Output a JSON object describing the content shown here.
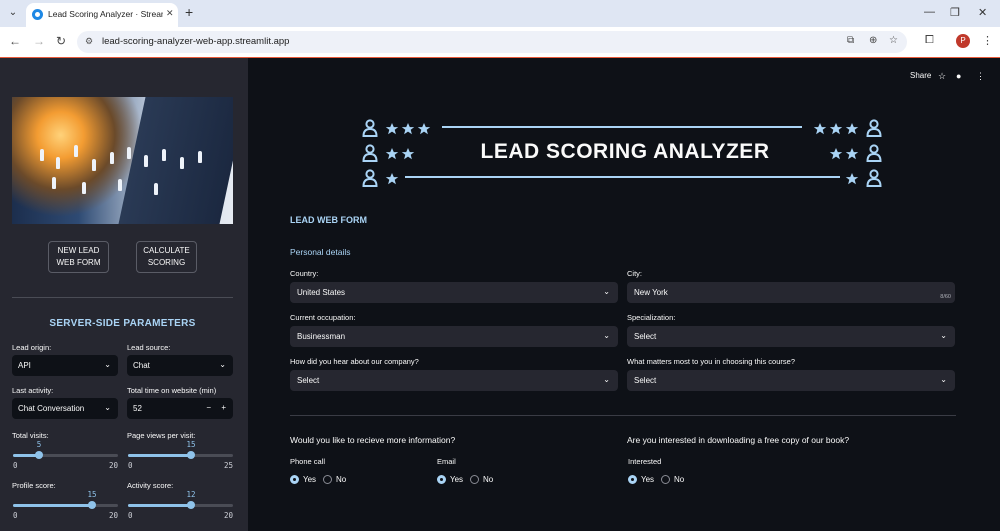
{
  "browser": {
    "tab_title": "Lead Scoring Analyzer · Streamlit",
    "url": "lead-scoring-analyzer-web-app.streamlit.app",
    "profile_initial": "P"
  },
  "header": {
    "share": "Share"
  },
  "sidebar": {
    "btn_new_lead": [
      "NEW LEAD",
      "WEB FORM"
    ],
    "btn_calc": [
      "CALCULATE",
      "SCORING"
    ],
    "title": "SERVER-SIDE PARAMETERS",
    "lead_origin": {
      "label": "Lead origin:",
      "value": "API"
    },
    "lead_source": {
      "label": "Lead source:",
      "value": "Chat"
    },
    "last_activity": {
      "label": "Last activity:",
      "value": "Chat Conversation"
    },
    "time_on_site": {
      "label": "Total time on website (min)",
      "value": "52"
    },
    "total_visits": {
      "label": "Total visits:",
      "value": 5,
      "min": 0,
      "max": 20
    },
    "page_views": {
      "label": "Page views per visit:",
      "value": 15,
      "min": 0,
      "max": 25
    },
    "profile_score": {
      "label": "Profile score:",
      "value": 15,
      "min": 0,
      "max": 20
    },
    "activity_score": {
      "label": "Activity score:",
      "value": 12,
      "min": 0,
      "max": 20
    }
  },
  "main": {
    "banner_title": "LEAD SCORING ANALYZER",
    "form_title": "LEAD WEB FORM",
    "section_personal": "Personal details",
    "country": {
      "label": "Country:",
      "value": "United States"
    },
    "city": {
      "label": "City:",
      "value": "New York",
      "counter": "8/60"
    },
    "occupation": {
      "label": "Current occupation:",
      "value": "Businessman"
    },
    "specialization": {
      "label": "Specialization:",
      "value": "Select"
    },
    "hear_about": {
      "label": "How did you hear about our company?",
      "value": "Select"
    },
    "matters_most": {
      "label": "What matters most to you in choosing this course?",
      "value": "Select"
    },
    "more_info_q": "Would you like to recieve more information?",
    "phone_call": {
      "label": "Phone call",
      "yes": "Yes",
      "no": "No",
      "selected": "Yes"
    },
    "email": {
      "label": "Email",
      "yes": "Yes",
      "no": "No",
      "selected": "Yes"
    },
    "book_q": "Are you interested in downloading a free copy of our book?",
    "interested": {
      "label": "Interested",
      "yes": "Yes",
      "no": "No",
      "selected": "Yes"
    }
  }
}
